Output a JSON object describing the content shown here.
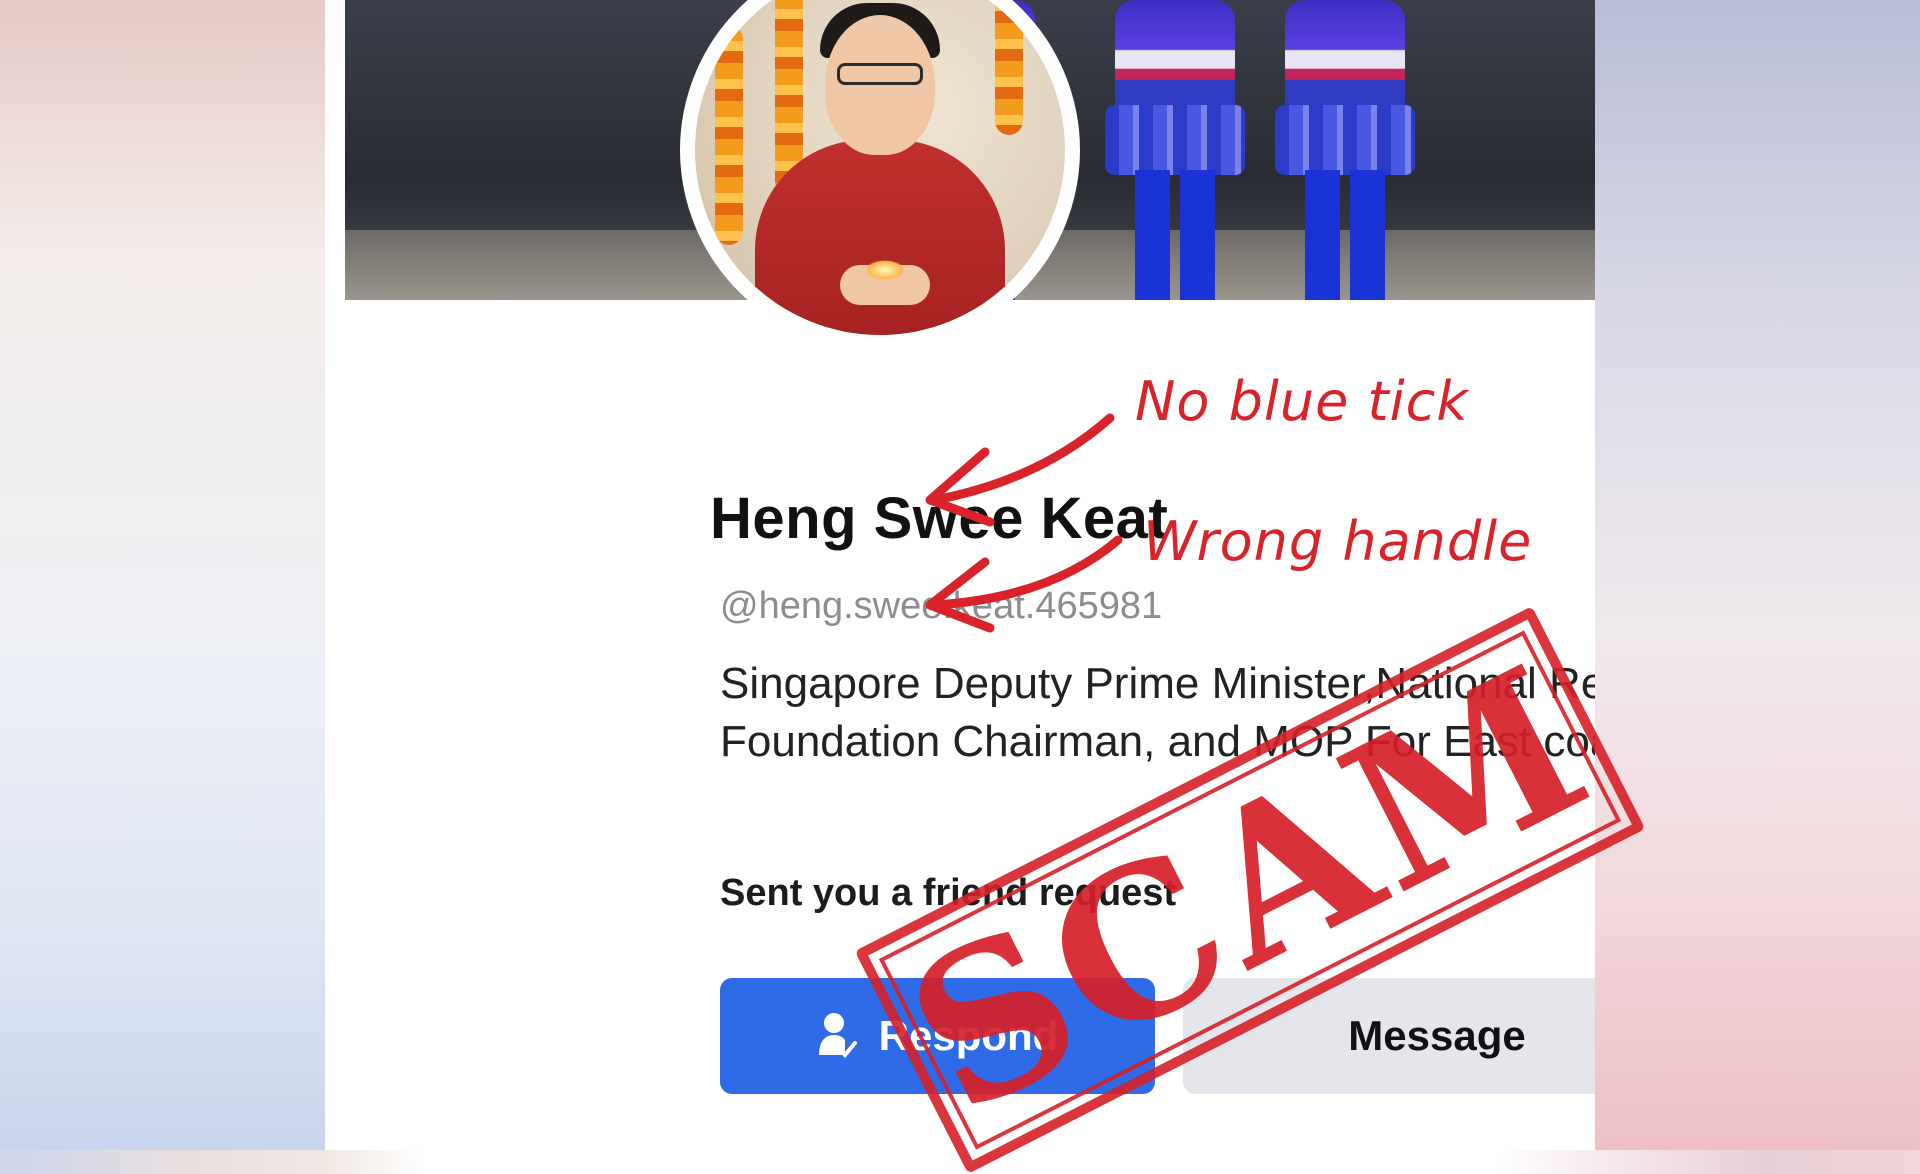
{
  "profile": {
    "name": "Heng Swee Keat",
    "handle": "@heng.swee.keat.465981",
    "bio": "Singapore Deputy Prime Minister,National Research Foundation Chairman, and MOP For East coast GRC",
    "request_text": "Sent you a friend request"
  },
  "actions": {
    "respond_label": "Respond",
    "message_label": "Message",
    "more_label": "···"
  },
  "annotations": {
    "note_1": "No blue tick",
    "note_2": "Wrong handle",
    "stamp": "SCAM"
  },
  "colors": {
    "accent": "#2f6be6",
    "annotation_red": "#d8232a"
  },
  "icons": {
    "respond": "person-check-icon",
    "more": "more-dots-icon",
    "arrow": "arrow-left-icon"
  }
}
